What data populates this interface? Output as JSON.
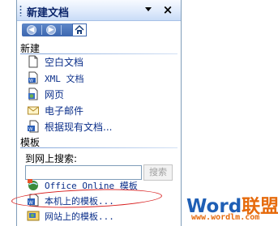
{
  "pane": {
    "title": "新建文档",
    "close_glyph": "×"
  },
  "nav": {
    "back_icon": "back-arrow-icon",
    "forward_icon": "forward-arrow-icon",
    "home_icon": "home-icon"
  },
  "new_section": {
    "heading": "新建",
    "items": [
      {
        "label": "空白文档",
        "icon": "blank-document-icon"
      },
      {
        "label": "XML 文档",
        "icon": "xml-document-icon"
      },
      {
        "label": "网页",
        "icon": "web-page-icon"
      },
      {
        "label": "电子邮件",
        "icon": "email-icon"
      },
      {
        "label": "根据现有文档...",
        "icon": "existing-document-icon"
      }
    ]
  },
  "templates_section": {
    "heading": "模板",
    "search_label": "到网上搜索:",
    "search_value": "",
    "search_button": "搜索",
    "items": [
      {
        "label": "Office Online 模板",
        "icon": "office-online-icon"
      },
      {
        "label": "本机上的模板...",
        "icon": "local-templates-icon"
      },
      {
        "label": "网站上的模板...",
        "icon": "website-templates-icon"
      }
    ]
  },
  "watermark": {
    "brand_word": "Word",
    "brand_cn": "联盟",
    "url": "www.wordlm.com"
  },
  "colors": {
    "link": "#0b2f8a",
    "title": "#0a246a",
    "highlight_ellipse": "#d81e1e",
    "watermark_blue": "#1f5fb5",
    "watermark_orange": "#e66b0d"
  }
}
